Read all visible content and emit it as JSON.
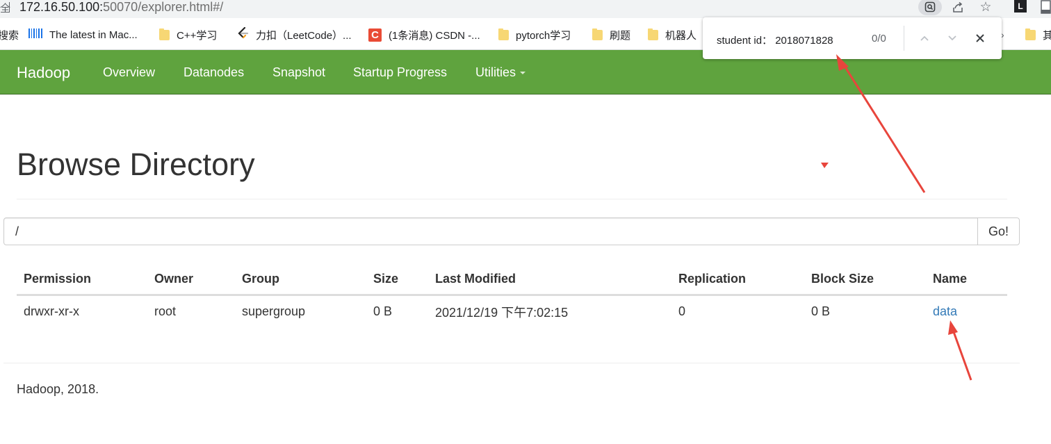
{
  "browser": {
    "addr_prefix": "全",
    "url_host": "172.16.50.100:",
    "url_port": "50070",
    "url_path": "/explorer.html#/",
    "bookmarks": [
      {
        "label": "搜索",
        "icon": "none"
      },
      {
        "label": "The latest in Mac...",
        "icon": "barcode-icon"
      },
      {
        "label": "C++学习",
        "icon": "folder-icon"
      },
      {
        "label": "力扣（LeetCode）...",
        "icon": "leetcode-icon"
      },
      {
        "label": "(1条消息) CSDN -...",
        "icon": "csdn-icon"
      },
      {
        "label": "pytorch学习",
        "icon": "folder-icon"
      },
      {
        "label": "刷题",
        "icon": "folder-icon"
      },
      {
        "label": "机器人",
        "icon": "folder-icon"
      },
      {
        "label": "其",
        "icon": "folder-icon"
      }
    ],
    "ext_label": "L",
    "colors": {
      "chrome_bg": "#f1f3f4",
      "csdn_red": "#e94b35",
      "folder": "#f7d774"
    }
  },
  "find_bar": {
    "query": "student id： 2018071828",
    "count": "0/0"
  },
  "navbar": {
    "brand": "Hadoop",
    "links": [
      "Overview",
      "Datanodes",
      "Snapshot",
      "Startup Progress",
      "Utilities"
    ],
    "color": "#5fa33e"
  },
  "page": {
    "title": "Browse Directory",
    "path_value": "/",
    "go_label": "Go!"
  },
  "table": {
    "headers": [
      "Permission",
      "Owner",
      "Group",
      "Size",
      "Last Modified",
      "Replication",
      "Block Size",
      "Name"
    ],
    "rows": [
      [
        "drwxr-xr-x",
        "root",
        "supergroup",
        "0 B",
        "2021/12/19 下午7:02:15",
        "0",
        "0 B",
        "data"
      ]
    ]
  },
  "footer": {
    "text": "Hadoop, 2018."
  },
  "annotation_color": "#e8453c"
}
